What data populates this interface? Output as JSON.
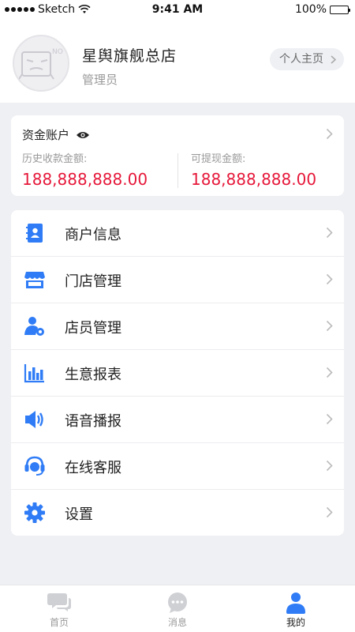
{
  "status_bar": {
    "carrier": "Sketch",
    "time": "9:41 AM",
    "battery": "100%"
  },
  "profile": {
    "store_name": "星舆旗舰总店",
    "role": "管理员",
    "home_button": "个人主页",
    "avatar_badge": "NO"
  },
  "fund": {
    "title": "资金账户",
    "history_label": "历史收款金额:",
    "history_value": "188,888,888.00",
    "withdraw_label": "可提现金额:",
    "withdraw_value": "188,888,888.00"
  },
  "menu": {
    "items": [
      {
        "label": "商户信息",
        "icon": "contact-book-icon"
      },
      {
        "label": "门店管理",
        "icon": "store-icon"
      },
      {
        "label": "店员管理",
        "icon": "staff-settings-icon"
      },
      {
        "label": "生意报表",
        "icon": "bar-chart-icon"
      },
      {
        "label": "语音播报",
        "icon": "speaker-icon"
      },
      {
        "label": "在线客服",
        "icon": "headset-icon"
      },
      {
        "label": "设置",
        "icon": "gear-icon"
      }
    ]
  },
  "tabbar": {
    "tabs": [
      {
        "label": "首页",
        "icon": "chat-bubble-icon"
      },
      {
        "label": "消息",
        "icon": "message-dots-icon"
      },
      {
        "label": "我的",
        "icon": "user-icon"
      }
    ],
    "active": "我的"
  },
  "colors": {
    "accent": "#2f7cf6",
    "amount": "#e6183a",
    "background": "#eff0f4",
    "muted": "#999999"
  }
}
